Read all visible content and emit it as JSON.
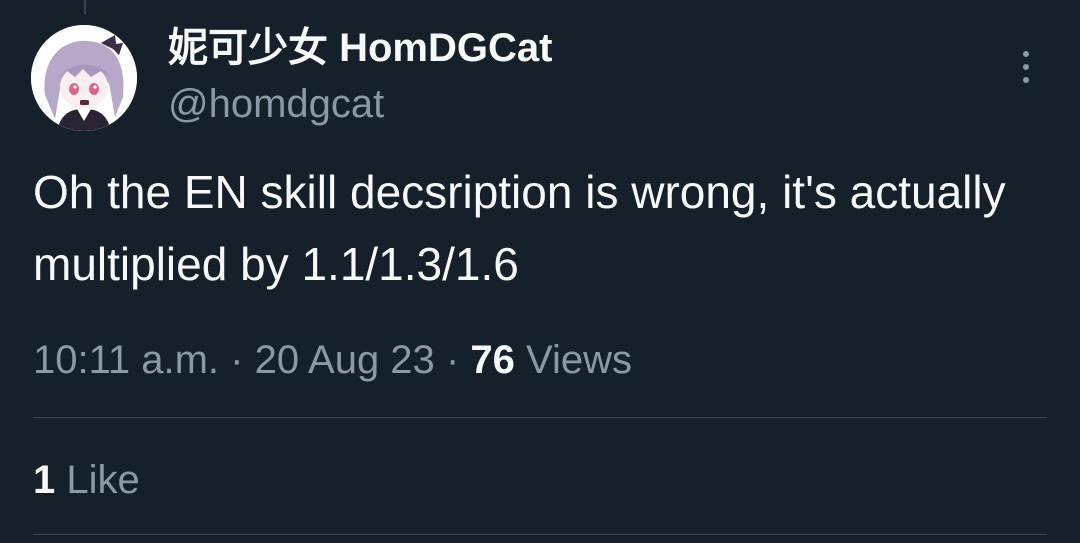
{
  "tweet": {
    "author": {
      "display_name": "妮可少女 HomDGCat",
      "handle": "@homdgcat"
    },
    "text": "Oh the EN skill decsription is wrong, it's actually multiplied by 1.1/1.3/1.6",
    "time": "10:11 a.m.",
    "separator": "·",
    "date": "20 Aug 23",
    "views_count": "76",
    "views_label": "Views",
    "likes_count": "1",
    "likes_label": "Like",
    "more_icon": "more-vertical-icon"
  },
  "colors": {
    "background": "#15202b",
    "primary_text": "#f7f9f9",
    "secondary_text": "#8b98a5",
    "divider": "#38444d"
  }
}
